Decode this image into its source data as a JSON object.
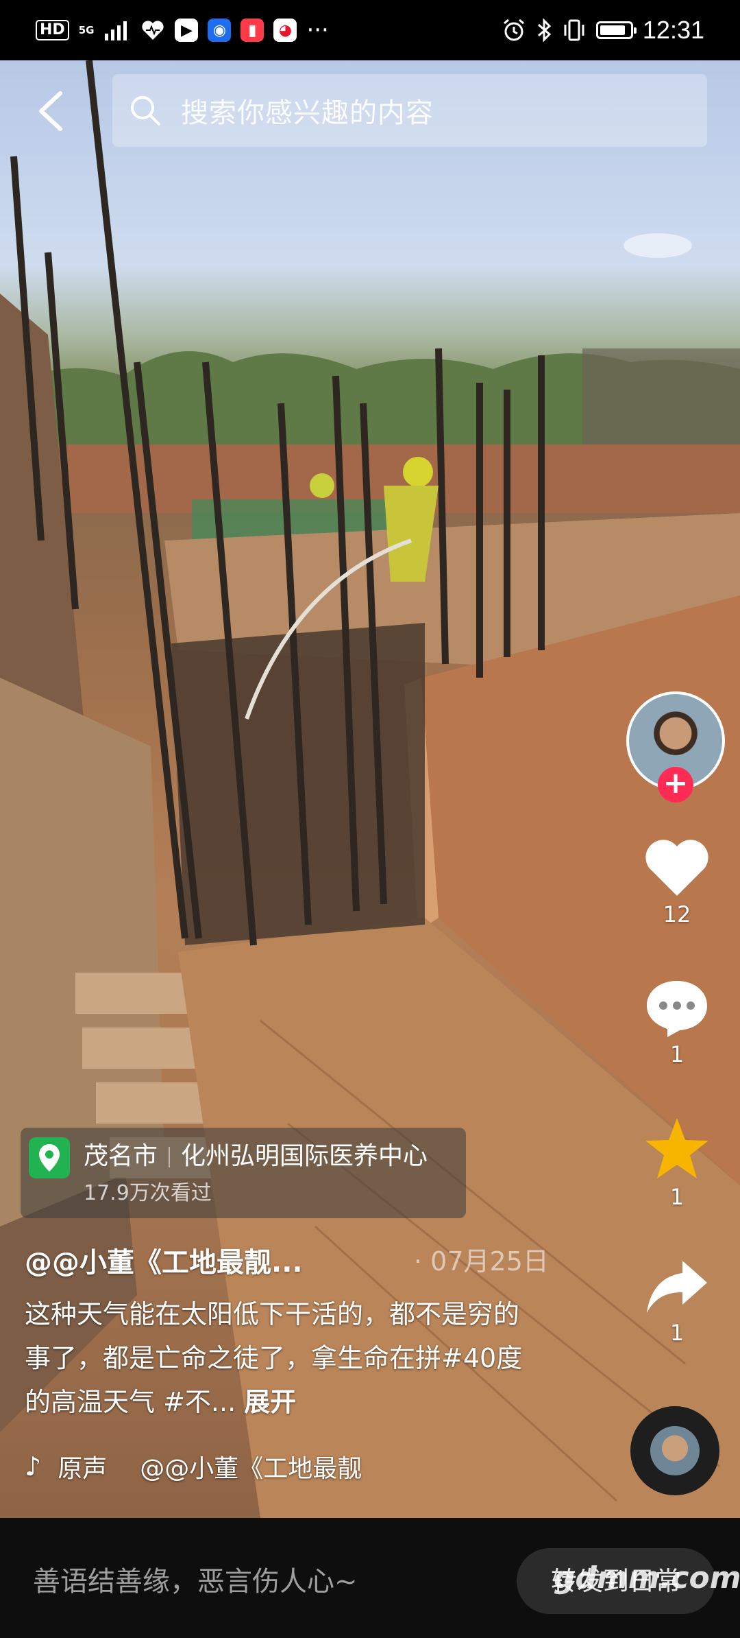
{
  "status_bar": {
    "hd": "HD",
    "network": "5G",
    "more": "···",
    "time": "12:31",
    "battery_level": 0.85,
    "app_icons": [
      "health-icon",
      "video-app-icon",
      "lightbulb-app-icon",
      "red-book-app-icon",
      "weibo-app-icon"
    ]
  },
  "search": {
    "placeholder": "搜索你感兴趣的内容"
  },
  "actions": {
    "like_count": "12",
    "comment_count": "1",
    "favorite_count": "1",
    "share_count": "1",
    "follow_symbol": "+"
  },
  "location": {
    "city": "茂名市",
    "place": "化州弘明国际医养中心",
    "views": "17.9万次看过"
  },
  "post": {
    "author": "@@小董《工地最靓...",
    "date": "· 07月25日",
    "description": "这种天气能在太阳低下干活的，都不是穷的事了，都是亡命之徒了，拿生命在拼#40度的高温天气 #不...",
    "expand_label": "展开"
  },
  "music": {
    "note_icon": "♪",
    "label": "原声",
    "artist": "@@小董《工地最靓"
  },
  "comment_bar": {
    "placeholder": "善语结善缘，恶言伤人心~",
    "share_button": "转发到日常"
  },
  "watermark": "gdmm.com",
  "colors": {
    "accent": "#fe2c55",
    "favorite": "#f7b500",
    "location_badge": "#21b351"
  }
}
